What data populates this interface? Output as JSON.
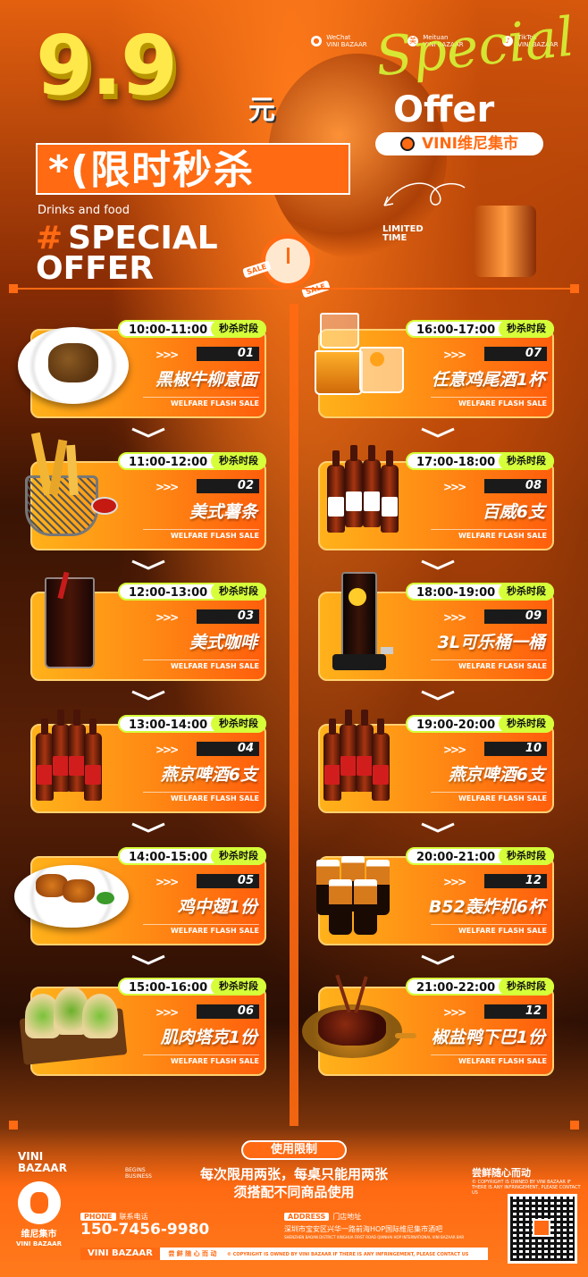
{
  "header": {
    "price": "9.9",
    "yuan": "元",
    "headline": "*(限时秒杀",
    "drinks": "Drinks and food",
    "special_hash": "#",
    "special_line1": "SPECIAL",
    "special_line2": "OFFER",
    "offer_script": "Special",
    "offer_word": "Offer",
    "vini_market": "VINI维尼集市",
    "limited_line1": "LIMITED",
    "limited_line2": "TIME",
    "sale": "SALE",
    "social": [
      {
        "icon": "wechat-icon",
        "line1": "WeChat",
        "line2": "VINI BAZAAR"
      },
      {
        "icon": "meituan-icon",
        "line1": "Meituan",
        "line2": "VINI BAZAAR"
      },
      {
        "icon": "tiktok-icon",
        "line1": "TikTok",
        "line2": "VINI BAZAAR"
      }
    ]
  },
  "cards_left": [
    {
      "time": "10:00-11:00",
      "tag": "秒杀时段",
      "arrows": ">>>",
      "num": "01",
      "name": "黑椒牛柳意面",
      "welfare": "WELFARE FLASH SALE"
    },
    {
      "time": "11:00-12:00",
      "tag": "秒杀时段",
      "arrows": ">>>",
      "num": "02",
      "name": "美式薯条",
      "welfare": "WELFARE FLASH SALE"
    },
    {
      "time": "12:00-13:00",
      "tag": "秒杀时段",
      "arrows": ">>>",
      "num": "03",
      "name": "美式咖啡",
      "welfare": "WELFARE FLASH SALE"
    },
    {
      "time": "13:00-14:00",
      "tag": "秒杀时段",
      "arrows": ">>>",
      "num": "04",
      "name": "燕京啤酒6支",
      "welfare": "WELFARE FLASH SALE"
    },
    {
      "time": "14:00-15:00",
      "tag": "秒杀时段",
      "arrows": ">>>",
      "num": "05",
      "name": "鸡中翅1份",
      "welfare": "WELFARE FLASH SALE"
    },
    {
      "time": "15:00-16:00",
      "tag": "秒杀时段",
      "arrows": ">>>",
      "num": "06",
      "name": "肌肉塔克1份",
      "welfare": "WELFARE FLASH SALE"
    }
  ],
  "cards_right": [
    {
      "time": "16:00-17:00",
      "tag": "秒杀时段",
      "arrows": ">>>",
      "num": "07",
      "name": "任意鸡尾酒1杯",
      "welfare": "WELFARE FLASH SALE"
    },
    {
      "time": "17:00-18:00",
      "tag": "秒杀时段",
      "arrows": ">>>",
      "num": "08",
      "name": "百威6支",
      "welfare": "WELFARE FLASH SALE"
    },
    {
      "time": "18:00-19:00",
      "tag": "秒杀时段",
      "arrows": ">>>",
      "num": "09",
      "name": "3L可乐桶一桶",
      "welfare": "WELFARE FLASH SALE"
    },
    {
      "time": "19:00-20:00",
      "tag": "秒杀时段",
      "arrows": ">>>",
      "num": "10",
      "name": "燕京啤酒6支",
      "welfare": "WELFARE FLASH SALE"
    },
    {
      "time": "20:00-21:00",
      "tag": "秒杀时段",
      "arrows": ">>>",
      "num": "12",
      "name": "B52轰炸机6杯",
      "welfare": "WELFARE FLASH SALE"
    },
    {
      "time": "21:00-22:00",
      "tag": "秒杀时段",
      "arrows": ">>>",
      "num": "12",
      "name": "椒盐鸭下巴1份",
      "welfare": "WELFARE FLASH SALE"
    }
  ],
  "footer": {
    "limit_label": "使用限制",
    "rule1": "每次限用两张，每桌只能用两张",
    "rule2": "须搭配不同商品使用",
    "brand_line1": "VINI",
    "brand_line2": "BAZAAR",
    "business_line1": "BEGINS",
    "business_line2": "BUSINESS",
    "bear_name1": "维尼集市",
    "bear_name2": "VINI BAZAAR",
    "motto": "尝鲜随心而动",
    "copyright": "© COPYRIGHT IS OWNED BY VINI BAZAAR IF THERE IS ANY INFRINGEMENT, PLEASE CONTACT US",
    "phone_label": "PHONE",
    "phone_sub": "联系电话",
    "phone": "150-7456-9980",
    "address_label": "ADDRESS",
    "address_sub": "门店地址",
    "address": "深圳市宝安区兴华一路前海HOP国际维尼集市酒吧",
    "address_en": "SHENZHEN BAOAN DISTRICT XINGHUA FIRST ROAD QIANHAI HOP INTERNATIONAL VINI BAZAAR BAR",
    "strip_brand": "VINI BAZAAR",
    "strip_cn": "尝 鲜 随 心 而 动",
    "strip_copy": "© COPYRIGHT IS OWNED BY VINI BAZAAR IF THERE IS ANY INFRINGEMENT, PLEASE CONTACT US"
  },
  "colors": {
    "accent": "#ff6a12",
    "lime": "#d6ff3a",
    "yellow": "#ffe84a"
  }
}
